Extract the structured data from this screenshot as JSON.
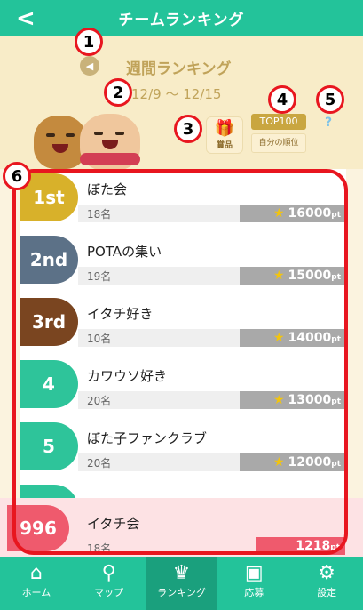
{
  "header": {
    "back": "<",
    "title": "チームランキング"
  },
  "week": {
    "title": "週間ランキング",
    "range": "12/9 ～ 12/15",
    "prev": "◀"
  },
  "buttons": {
    "prize": "賞品",
    "top100": "TOP100",
    "self_rank": "自分の順位",
    "help": "?"
  },
  "ranking": [
    {
      "badge": "1st",
      "name": "ぼた会",
      "members": "18名",
      "points": "16000",
      "unit": "pt",
      "color": "#d8b12a"
    },
    {
      "badge": "2nd",
      "name": "POTAの集い",
      "members": "19名",
      "points": "15000",
      "unit": "pt",
      "color": "#5c7187"
    },
    {
      "badge": "3rd",
      "name": "イタチ好き",
      "members": "10名",
      "points": "14000",
      "unit": "pt",
      "color": "#7a4520"
    },
    {
      "badge": "4",
      "name": "カワウソ好き",
      "members": "20名",
      "points": "13000",
      "unit": "pt",
      "color": "#2ec49a"
    },
    {
      "badge": "5",
      "name": "ぼた子ファンクラブ",
      "members": "20名",
      "points": "12000",
      "unit": "pt",
      "color": "#2ec49a"
    }
  ],
  "my_team": {
    "badge": "996",
    "name": "イタチ会",
    "members": "18名",
    "points": "1218",
    "unit": "pt"
  },
  "callouts": [
    "1",
    "2",
    "3",
    "4",
    "5",
    "6"
  ],
  "tabs": [
    {
      "icon": "⌂",
      "label": "ホーム"
    },
    {
      "icon": "⚲",
      "label": "マップ"
    },
    {
      "icon": "♛",
      "label": "ランキング"
    },
    {
      "icon": "▣",
      "label": "応募"
    },
    {
      "icon": "⚙",
      "label": "設定"
    }
  ],
  "colors": {
    "header": "#23c39a",
    "annotation": "#e8161f"
  }
}
